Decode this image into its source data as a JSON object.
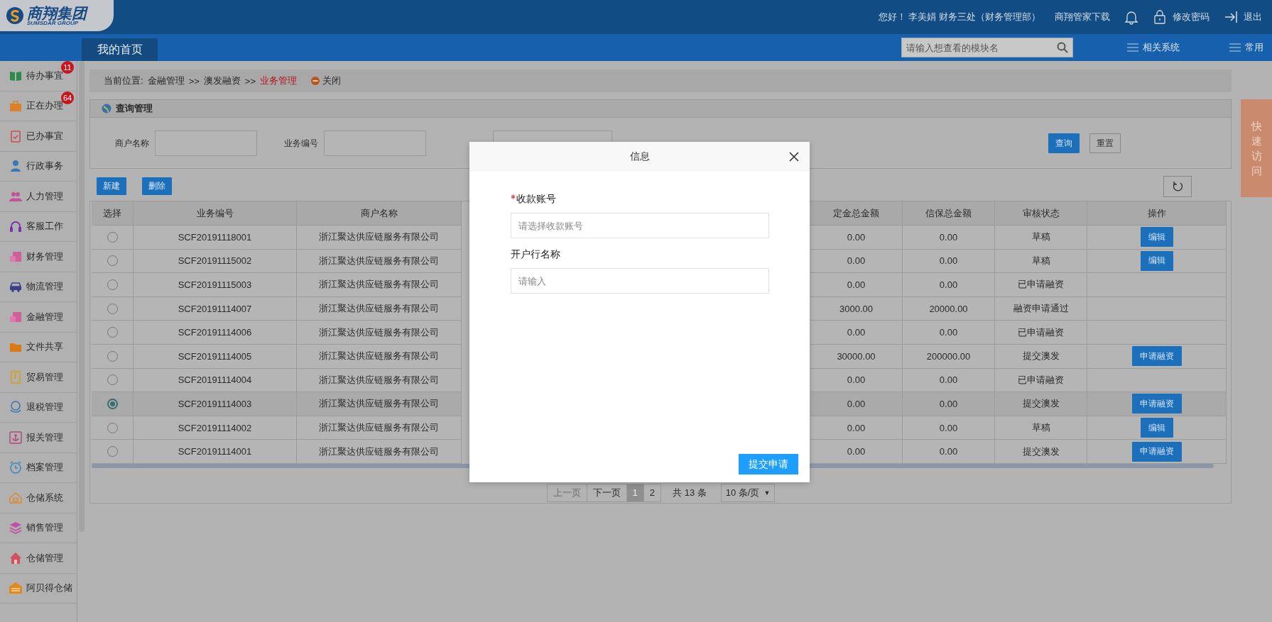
{
  "header": {
    "logo": {
      "name": "商翔集团",
      "subtitle": "SUMSDAR GROUP"
    },
    "greeting": "您好！ 李美娟 财务三处（财务管理部）",
    "download": "商翔管家下载",
    "change_password": "修改密码",
    "logout": "退出"
  },
  "nav": {
    "tabs": [
      {
        "label": "我的首页",
        "selected": true
      }
    ],
    "search": {
      "placeholder": "请输入想查看的模块名"
    },
    "links": [
      "相关系统",
      "常用"
    ]
  },
  "sidebar": {
    "items": [
      {
        "label": "待办事宜",
        "badge": "11"
      },
      {
        "label": "正在办理",
        "badge": "64"
      },
      {
        "label": "已办事宜"
      },
      {
        "label": "行政事务"
      },
      {
        "label": "人力管理"
      },
      {
        "label": "客服工作"
      },
      {
        "label": "财务管理"
      },
      {
        "label": "物流管理"
      },
      {
        "label": "金融管理"
      },
      {
        "label": "文件共享"
      },
      {
        "label": "贸易管理"
      },
      {
        "label": "退税管理"
      },
      {
        "label": "报关管理"
      },
      {
        "label": "档案管理"
      },
      {
        "label": "仓储系统"
      },
      {
        "label": "销售管理"
      },
      {
        "label": "仓储管理"
      },
      {
        "label": "阿贝得仓储"
      }
    ]
  },
  "breadcrumb": {
    "prefix": "当前位置:",
    "items": [
      {
        "label": "金融管理",
        "separator": ">>",
        "current": false
      },
      {
        "label": "澳发融资",
        "separator": ">>",
        "current": false
      },
      {
        "label": "业务管理",
        "current": true
      }
    ],
    "close": "关闭"
  },
  "query": {
    "title": "查询管理",
    "fields": [
      {
        "label": "商户名称",
        "kind": "text"
      },
      {
        "label": "业务编号",
        "kind": "text"
      },
      {
        "kind": "select"
      }
    ],
    "buttons": [
      {
        "label": "查询",
        "kind": "primary"
      },
      {
        "label": "重置",
        "kind": "default"
      }
    ]
  },
  "toolbar": [
    "新建",
    "删除"
  ],
  "table": {
    "columns": [
      "选择",
      "业务编号",
      "商户名称",
      "定金总金额",
      "信保总金额",
      "审核状态",
      "操作"
    ],
    "rows": [
      {
        "selected": false,
        "id": "SCF20191118001",
        "merchant": "浙江聚达供应链服务有限公司",
        "deposit": "0.00",
        "guarantee": "0.00",
        "status": "草稿",
        "action": "编辑"
      },
      {
        "selected": false,
        "id": "SCF20191115002",
        "merchant": "浙江聚达供应链服务有限公司",
        "deposit": "0.00",
        "guarantee": "0.00",
        "status": "草稿",
        "action": "编辑"
      },
      {
        "selected": false,
        "id": "SCF20191115003",
        "merchant": "浙江聚达供应链服务有限公司",
        "deposit": "0.00",
        "guarantee": "0.00",
        "status": "已申请融资"
      },
      {
        "selected": false,
        "id": "SCF20191114007",
        "merchant": "浙江聚达供应链服务有限公司",
        "deposit": "3000.00",
        "guarantee": "20000.00",
        "status": "融资申请通过"
      },
      {
        "selected": false,
        "id": "SCF20191114006",
        "merchant": "浙江聚达供应链服务有限公司",
        "deposit": "0.00",
        "guarantee": "0.00",
        "status": "已申请融资"
      },
      {
        "selected": false,
        "id": "SCF20191114005",
        "merchant": "浙江聚达供应链服务有限公司",
        "deposit": "30000.00",
        "guarantee": "200000.00",
        "status": "提交澳发",
        "action": "申请融资"
      },
      {
        "selected": false,
        "id": "SCF20191114004",
        "merchant": "浙江聚达供应链服务有限公司",
        "deposit": "0.00",
        "guarantee": "0.00",
        "status": "已申请融资"
      },
      {
        "selected": true,
        "id": "SCF20191114003",
        "merchant": "浙江聚达供应链服务有限公司",
        "deposit": "0.00",
        "guarantee": "0.00",
        "status": "提交澳发",
        "action": "申请融资"
      },
      {
        "selected": false,
        "id": "SCF20191114002",
        "merchant": "浙江聚达供应链服务有限公司",
        "deposit": "0.00",
        "guarantee": "0.00",
        "status": "草稿",
        "action": "编辑"
      },
      {
        "selected": false,
        "id": "SCF20191114001",
        "merchant": "浙江聚达供应链服务有限公司",
        "deposit": "0.00",
        "guarantee": "0.00",
        "status": "提交澳发",
        "action": "申请融资"
      }
    ]
  },
  "pagination": {
    "prev": {
      "label": "上一页",
      "disabled": true
    },
    "next": {
      "label": "下一页",
      "disabled": false
    },
    "pages": [
      {
        "label": "1",
        "selected": true
      },
      {
        "label": "2",
        "selected": false
      }
    ],
    "total": "共 13 条",
    "page_size": "10 条/页",
    "page_size_caret": "▼"
  },
  "quick_access": "快速访问",
  "modal": {
    "title": "信息",
    "fields": [
      {
        "label": "收款账号",
        "required": true,
        "placeholder": "请选择收款账号"
      },
      {
        "label": "开户行名称",
        "required": false,
        "placeholder": "请输入"
      }
    ],
    "submit": "提交申请"
  }
}
